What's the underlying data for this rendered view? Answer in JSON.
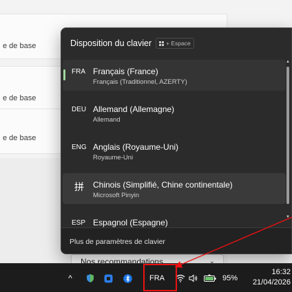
{
  "background": {
    "card_labels": [
      "e de base",
      "e de base",
      "e de base"
    ],
    "dropdown": {
      "value": "Nos recommandations",
      "chevron_icon": "chevron-down-icon"
    }
  },
  "flyout": {
    "title": "Disposition du clavier",
    "shortcut": {
      "icon": "windows-key-icon",
      "text": "+ Espace"
    },
    "languages": [
      {
        "code": "FRA",
        "name": "Français (France)",
        "layout": "Français (Traditionnel, AZERTY)",
        "selected": true
      },
      {
        "code": "DEU",
        "name": "Allemand (Allemagne)",
        "layout": "Allemand"
      },
      {
        "code": "ENG",
        "name": "Anglais (Royaume-Uni)",
        "layout": "Royaume-Uni"
      },
      {
        "code": "拼",
        "name": "Chinois (Simplifié, Chine continentale)",
        "layout": "Microsoft Pinyin",
        "hovered": true
      },
      {
        "code": "ESP",
        "name": "Espagnol (Espagne)",
        "layout": ""
      }
    ],
    "footer_link": "Plus de paramètres de clavier"
  },
  "taskbar": {
    "chevron": "^",
    "input_indicator": "FRA",
    "battery": "95%",
    "time": "16:32",
    "date": "21/04/2026"
  },
  "colors": {
    "flyout_bg": "#2b2b2b",
    "selection_accent": "#9fd89f",
    "taskbar_bg": "#1c1c1c",
    "annotation_red": "#e11111"
  }
}
